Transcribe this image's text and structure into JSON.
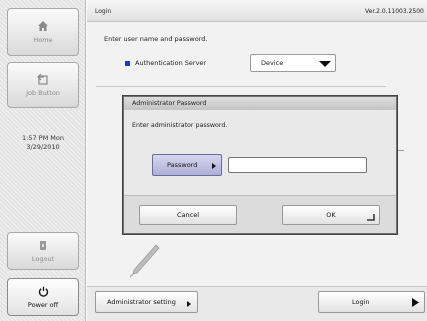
{
  "header": {
    "title": "Login",
    "version": "Ver.2.0.11003.2500"
  },
  "sidebar": {
    "home_label": "Home",
    "job_button_label": "Job Button",
    "clock_time": "1:57 PM Mon",
    "clock_date": "3/29/2010",
    "logout_label": "Logout",
    "power_off_label": "Power off"
  },
  "main": {
    "instruction": "Enter user name and password.",
    "auth_server_label": "Authentication Server",
    "auth_server_value": "Device",
    "accent_color": "#1a3fb5"
  },
  "dialog": {
    "title": "Administrator Password",
    "message": "Enter administrator password.",
    "password_button": "Password",
    "password_value": "",
    "cancel_label": "Cancel",
    "ok_label": "OK"
  },
  "footer": {
    "admin_setting_label": "Administrator setting",
    "login_label": "Login"
  }
}
